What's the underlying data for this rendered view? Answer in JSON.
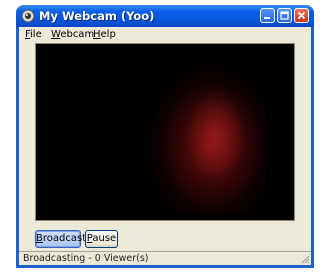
{
  "window": {
    "title": "My Webcam (Yoo)",
    "controls": {
      "minimize_icon": "minimize-icon",
      "maximize_icon": "maximize-icon",
      "close_icon": "close-icon"
    }
  },
  "menu": {
    "items": [
      {
        "label": "File",
        "accel": "F",
        "rest": "ile"
      },
      {
        "label": "Webcam",
        "accel": "W",
        "rest": "ebcam"
      },
      {
        "label": "Help",
        "accel": "H",
        "rest": "elp"
      }
    ]
  },
  "toolbar": {
    "broadcast": {
      "label": "Broadcast",
      "accel": "B",
      "rest": "roadcast"
    },
    "pause": {
      "label": "Pause",
      "accel": "P",
      "rest": "ause"
    }
  },
  "status": {
    "text": "Broadcasting - 0 Viewer(s)"
  },
  "colors": {
    "titlebar": "#0a5ee8",
    "client": "#ece9d8",
    "video": "#000000",
    "face_tint": "#8c1414"
  }
}
